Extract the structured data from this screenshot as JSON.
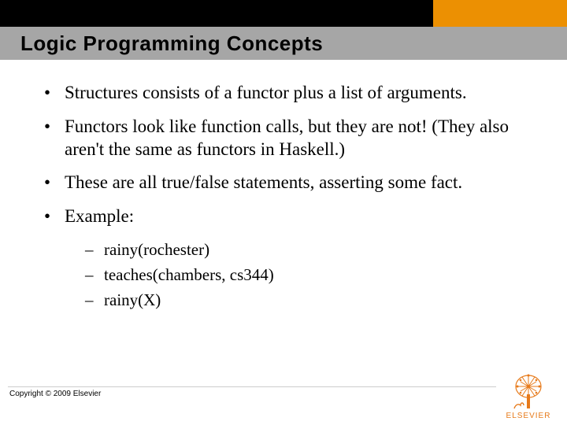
{
  "header": {
    "title": "Logic Programming Concepts"
  },
  "bullets": [
    "Structures consists of a functor plus a list of arguments.",
    "Functors look like function calls, but they are not! (They also aren't the same as functors in Haskell.)",
    "These are all true/false statements, asserting some fact.",
    "Example:"
  ],
  "sub_bullets": [
    "rainy(rochester)",
    "teaches(chambers, cs344)",
    "rainy(X)"
  ],
  "footer": {
    "copyright": "Copyright © 2009 Elsevier",
    "logo_text": "ELSEVIER"
  }
}
